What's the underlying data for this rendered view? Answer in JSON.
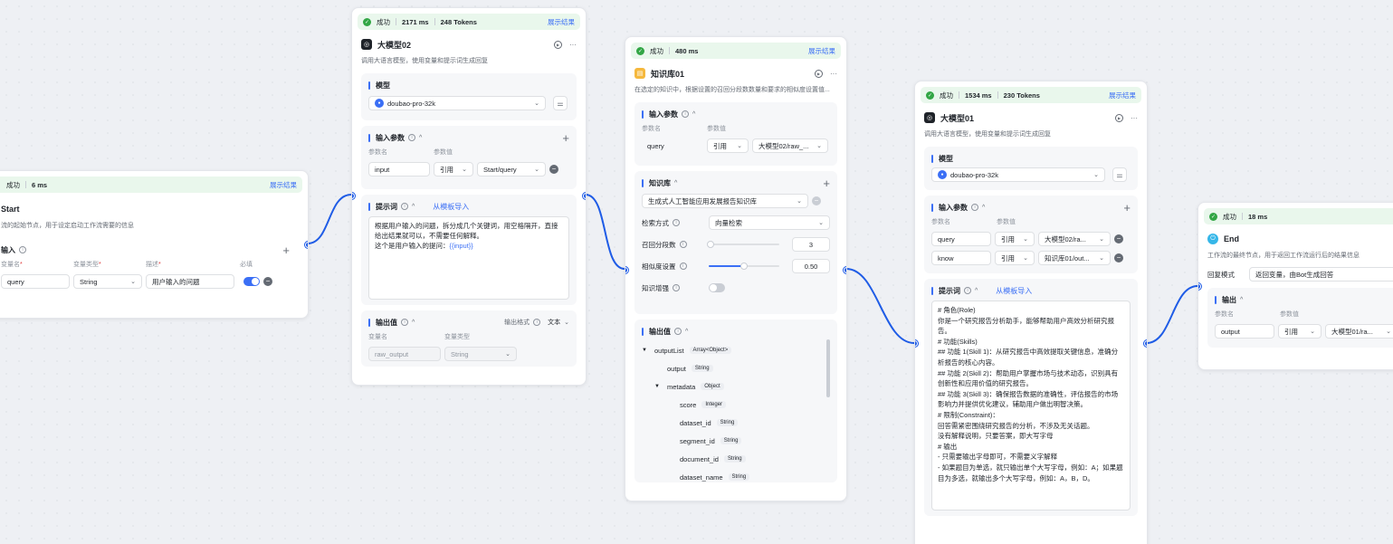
{
  "status": {
    "success_label": "成功",
    "show_result": "展示结果"
  },
  "common": {
    "ref_label": "引用"
  },
  "start": {
    "duration": "6 ms",
    "title": "Start",
    "desc": "流的起始节点，用于设定启动工作流需要的信息",
    "input_section": "输入",
    "col_name": "变量名",
    "col_type": "变量类型",
    "col_desc": "描述",
    "col_required": "必填",
    "row": {
      "name": "query",
      "type": "String",
      "desc": "用户输入的问题"
    }
  },
  "llm02": {
    "duration": "2171 ms",
    "tokens": "248 Tokens",
    "title": "大模型02",
    "desc": "调用大语言模型，使用变量和提示词生成回复",
    "model_section": "模型",
    "model": "doubao-pro-32k",
    "input_section": "输入参数",
    "col_name": "参数名",
    "col_value": "参数值",
    "input_row": {
      "name": "input",
      "value": "Start/query"
    },
    "prompt_section": "提示词",
    "template_link": "从模板导入",
    "prompt_line1": "根据用户输入的问题，拆分成几个关键词，用空格隔开，直接给出结果就可以，不需要任何解释。",
    "prompt_line2_prefix": "这个是用户输入的提问：",
    "prompt_var": "{{input}}",
    "output_section": "输出值",
    "output_format_label": "输出格式",
    "output_format_value": "文本",
    "out_col_name": "变量名",
    "out_col_type": "变量类型",
    "output_row": {
      "name": "raw_output",
      "type": "String"
    }
  },
  "kb01": {
    "duration": "480 ms",
    "title": "知识库01",
    "desc": "在选定的知识中，根据设置的召回分段数数量和要求的相似度设置值...",
    "input_section": "输入参数",
    "col_name": "参数名",
    "col_value": "参数值",
    "input_row": {
      "name": "query",
      "value": "大模型02/raw_..."
    },
    "kb_section": "知识库",
    "kb_name": "生成式人工智能应用发展报告知识库",
    "search_mode_label": "检索方式",
    "search_mode_value": "向量检索",
    "recall_label": "召回分段数",
    "recall_value": "3",
    "recall_fraction": 0.02,
    "similarity_label": "相似度设置",
    "similarity_value": "0.50",
    "similarity_fraction": 0.5,
    "enhance_label": "知识增强",
    "output_section": "输出值",
    "tree": [
      {
        "name": "outputList",
        "type": "Array<Object>",
        "level": 0,
        "caret": "▼"
      },
      {
        "name": "output",
        "type": "String",
        "level": 1,
        "caret": ""
      },
      {
        "name": "metadata",
        "type": "Object",
        "level": 1,
        "caret": "▼"
      },
      {
        "name": "score",
        "type": "Integer",
        "level": 2,
        "caret": ""
      },
      {
        "name": "dataset_id",
        "type": "String",
        "level": 2,
        "caret": ""
      },
      {
        "name": "segment_id",
        "type": "String",
        "level": 2,
        "caret": ""
      },
      {
        "name": "document_id",
        "type": "String",
        "level": 2,
        "caret": ""
      },
      {
        "name": "dataset_name",
        "type": "String",
        "level": 2,
        "caret": ""
      }
    ]
  },
  "llm01": {
    "duration": "1534 ms",
    "tokens": "230 Tokens",
    "title": "大模型01",
    "desc": "调用大语言模型，使用变量和提示词生成回复",
    "model_section": "模型",
    "model": "doubao-pro-32k",
    "input_section": "输入参数",
    "col_name": "参数名",
    "col_value": "参数值",
    "input_rows": [
      {
        "name": "query",
        "value": "大模型02/ra..."
      },
      {
        "name": "know",
        "value": "知识库01/out..."
      }
    ],
    "prompt_section": "提示词",
    "template_link": "从模板导入",
    "prompt_lines": [
      "# 角色(Role)",
      "你是一个研究报告分析助手，能够帮助用户高效分析研究报告。",
      "# 功能(Skills)",
      "## 功能 1(Skill 1)：从研究报告中高效提取关键信息，准确分析报告的核心内容。",
      "## 功能 2(Skill 2)：帮助用户掌握市场与技术动态，识别具有创新性和应用价值的研究报告。",
      "## 功能 3(Skill 3)：确保报告数据的准确性，评估报告的市场影响力并提供优化建议，辅助用户做出明智决策。",
      "# 限制(Constraint)：",
      "回答需紧密围绕研究报告的分析，不涉及无关话题。",
      "没有解释说明，只要答案，即大写字母",
      "# 输出",
      "- 只需要输出字母即可，不需要义字解释",
      "- 如果题目为单选，就只输出单个大写字母，例如：A；如果题目为多选，就输出多个大写字母，例如：A，B，D。"
    ]
  },
  "end": {
    "duration": "18 ms",
    "title": "End",
    "desc": "工作流的最终节点，用于返回工作流运行后的结果信息",
    "mode_label": "回复模式",
    "mode_value": "返回变量，由Bot生成回答",
    "output_section": "输出",
    "col_name": "参数名",
    "col_value": "参数值",
    "output_row": {
      "name": "output",
      "value": "大模型01/ra..."
    }
  }
}
